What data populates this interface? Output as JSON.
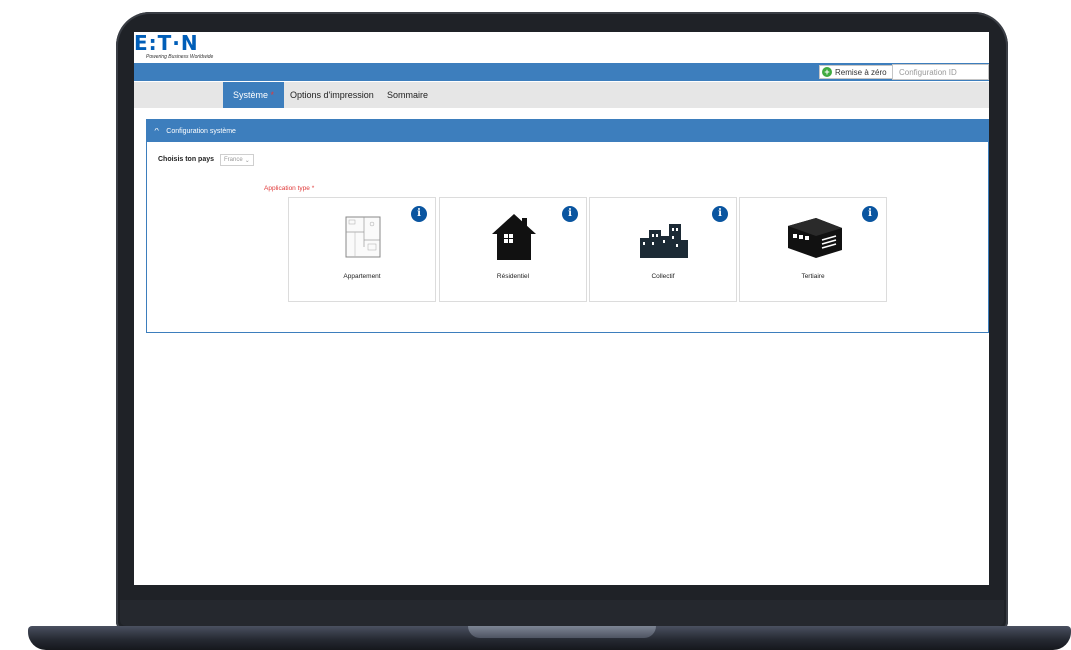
{
  "brand": {
    "logo_text": "E:T·N",
    "tagline": "Powering Business Worldwide"
  },
  "topbar": {
    "reset_label": "Remise à zéro",
    "config_placeholder": "Configuration ID"
  },
  "tabs": [
    {
      "label": "Système",
      "required": "*",
      "active": true
    },
    {
      "label": "Options d'impression"
    },
    {
      "label": "Sommaire"
    }
  ],
  "panel": {
    "title": "Configuration système",
    "country_label": "Choisis ton pays",
    "country_value": "France",
    "application_type_label": "Application type *",
    "cards": [
      {
        "label": "Appartement",
        "icon": "floorplan-icon"
      },
      {
        "label": "Résidentiel",
        "icon": "house-icon"
      },
      {
        "label": "Collectif",
        "icon": "buildings-icon"
      },
      {
        "label": "Tertiaire",
        "icon": "warehouse-icon"
      }
    ]
  },
  "colors": {
    "brand_blue": "#3d7ebd",
    "info_blue": "#0a55a0",
    "required_red": "#e03a3a",
    "reset_green": "#3faa3f"
  }
}
